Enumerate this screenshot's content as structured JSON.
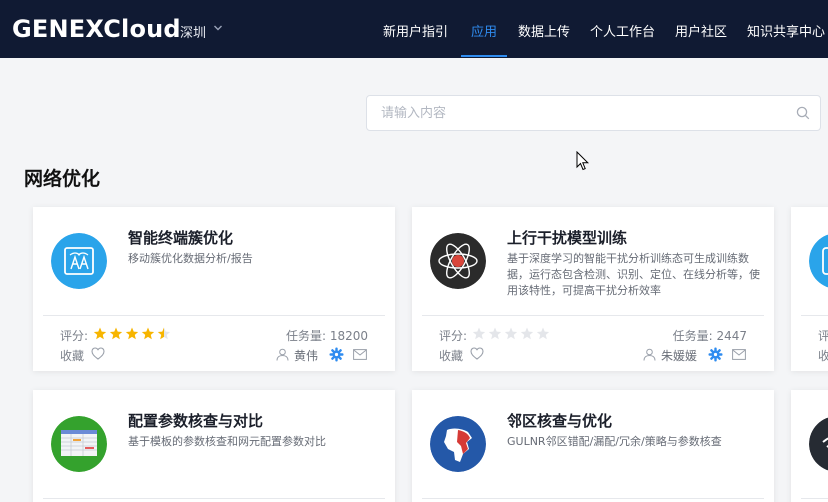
{
  "header": {
    "logo": "GENEXCloud",
    "city": "深圳",
    "nav": [
      {
        "label": "新用户指引",
        "active": false
      },
      {
        "label": "应用",
        "active": true
      },
      {
        "label": "数据上传",
        "active": false
      },
      {
        "label": "个人工作台",
        "active": false
      },
      {
        "label": "用户社区",
        "active": false
      },
      {
        "label": "知识共享中心",
        "active": false
      }
    ]
  },
  "search": {
    "placeholder": "请输入内容",
    "value": ""
  },
  "section": {
    "title": "网络优化"
  },
  "labels": {
    "rating": "评分:",
    "favorite": "收藏",
    "task_prefix": "任务量: "
  },
  "cards": [
    {
      "title": "智能终端簇优化",
      "desc": "移动簇优化数据分析/报告",
      "rating": 4.5,
      "tasks": "18200",
      "author": "黄伟",
      "icon": "antenna-icon",
      "accent": "#2aa4ea"
    },
    {
      "title": "上行干扰模型训练",
      "desc": "基于深度学习的智能干扰分析训练态可生成训练数据，运行态包含检测、识别、定位、在线分析等，使用该特性，可提高干扰分析效率",
      "rating": 0,
      "tasks": "2447",
      "author": "朱媛媛",
      "icon": "atom-icon",
      "accent": "#2b2b2b"
    },
    {
      "title": "配置参数核查与对比",
      "desc": "基于模板的参数核查和网元配置参数对比",
      "icon": "table-icon",
      "accent": "#34a22d"
    },
    {
      "title": "邻区核查与优化",
      "desc": "GULNR邻区错配/漏配/冗余/策略与参数核查",
      "icon": "map-icon",
      "accent": "#2458a8"
    }
  ],
  "colors": {
    "header_bg": "#101a33",
    "accent": "#2f8cf0",
    "star": "#f7b500"
  }
}
